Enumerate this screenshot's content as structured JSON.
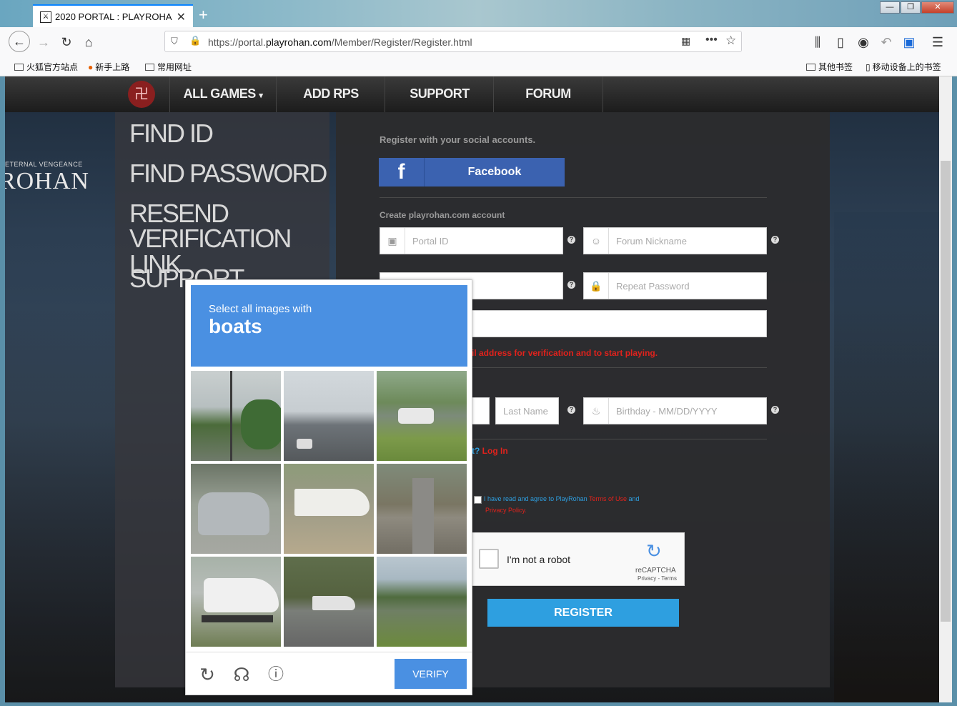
{
  "browser": {
    "tab_title": "2020 PORTAL : PLAYROHAN",
    "url_prefix": "https://portal.",
    "url_domain": "playrohan.com",
    "url_path": "/Member/Register/Register.html",
    "bookmarks": [
      "火狐官方站点",
      "新手上路",
      "常用网址"
    ],
    "bookmarks_right": [
      "其他书签",
      "移动设备上的书签"
    ]
  },
  "site_nav": {
    "items": [
      "ALL GAMES",
      "ADD RPS",
      "SUPPORT",
      "FORUM"
    ]
  },
  "left_menu": {
    "find_id": "FIND ID",
    "find_password": "FIND PASSWORD",
    "resend_line1": "RESEND",
    "resend_line2": "VERIFICATION LINK",
    "support": "SUPPORT",
    "brand_small": "ETERNAL VENGEANCE",
    "brand_big": "ROHAN"
  },
  "form": {
    "social_label": "Register with your social accounts.",
    "facebook_label": "Facebook",
    "create_label": "Create playrohan.com account",
    "portal_id_ph": "Portal ID",
    "forum_nick_ph": "Forum Nickname",
    "repeat_pw_ph": "Repeat Password",
    "email_note": "il address for verification and to start playing.",
    "last_name_ph": "Last Name",
    "birthday_ph": "Birthday - MM/DD/YYYY",
    "login_q": "t?",
    "login_link": "Log In",
    "agree_text": "I have read and agree to PlayRohan",
    "terms_link": "Terms of Use",
    "and_text": "and",
    "privacy_link": "Privacy Policy.",
    "robot_label": "I'm not a robot",
    "recaptcha_brand": "reCAPTCHA",
    "recaptcha_links": "Privacy - Terms",
    "register_label": "REGISTER"
  },
  "challenge": {
    "prompt": "Select all images with",
    "target": "boats",
    "verify_label": "VERIFY",
    "tiles": [
      "street-power-lines",
      "road-intersection",
      "white-suv-grass",
      "silver-car-parked",
      "boat-on-trailer",
      "street-parked-cars",
      "boat-on-trailer-large",
      "boat-on-street",
      "road-grass-trees"
    ]
  }
}
